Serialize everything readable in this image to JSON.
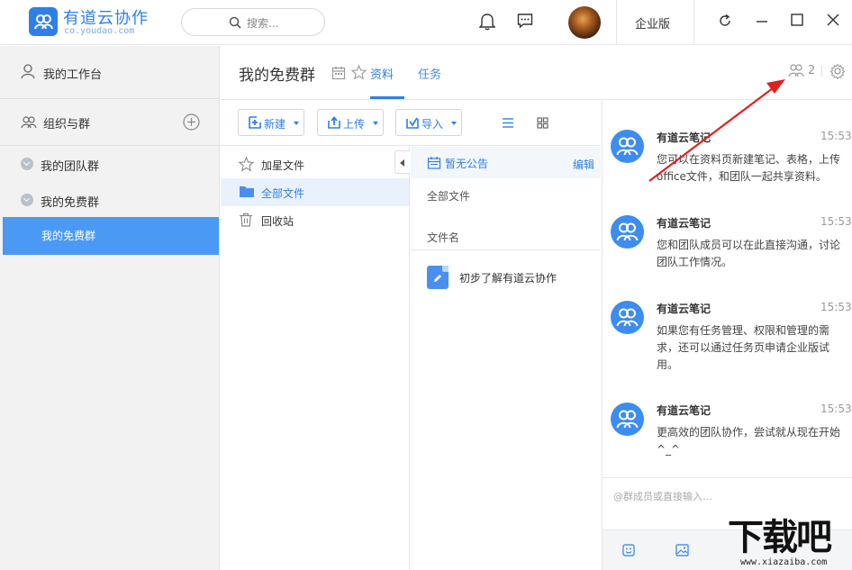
{
  "app": {
    "brand_name": "有道云协作",
    "brand_url": "co.youdao.com",
    "search_placeholder": "搜索...",
    "edition_label": "企业版"
  },
  "sidebar": {
    "workspace": "我的工作台",
    "orgs": "组织与群",
    "groups": [
      {
        "label": "我的团队群"
      },
      {
        "label": "我的免费群"
      }
    ],
    "active_item": "我的免费群"
  },
  "content": {
    "group_title": "我的免费群",
    "tabs": [
      {
        "label": "资料",
        "active": true
      },
      {
        "label": "任务",
        "active": false
      }
    ],
    "member_count": "2"
  },
  "toolbar": {
    "new_label": "新建",
    "upload_label": "上传",
    "import_label": "导入"
  },
  "folders": [
    {
      "label": "加星文件",
      "icon": "star-icon"
    },
    {
      "label": "全部文件",
      "icon": "folder-icon",
      "active": true
    },
    {
      "label": "回收站",
      "icon": "trash-icon"
    }
  ],
  "filelist": {
    "notice": "暂无公告",
    "notice_edit": "编辑",
    "breadcrumb": "全部文件",
    "column_header": "文件名",
    "files": [
      {
        "name": "初步了解有道云协作"
      }
    ]
  },
  "chat": {
    "messages": [
      {
        "sender": "有道云笔记",
        "time": "15:53",
        "text": "您可以在资料页新建笔记、表格，上传office文件，和团队一起共享资料。"
      },
      {
        "sender": "有道云笔记",
        "time": "15:53",
        "text": "您和团队成员可以在此直接沟通，讨论团队工作情况。"
      },
      {
        "sender": "有道云笔记",
        "time": "15:53",
        "text": "如果您有任务管理、权限和管理的需求，还可以通过任务页申请企业版试用。"
      },
      {
        "sender": "有道云笔记",
        "time": "15:53",
        "text": "更高效的团队协作，尝试就从现在开始^_^"
      }
    ],
    "input_placeholder": "@群成员或直接输入…"
  },
  "watermark": {
    "text": "下载吧",
    "url": "www.xiazaiba.com"
  },
  "colors": {
    "accent": "#2f7fe8",
    "active_item": "#4a9af5",
    "annotation_arrow": "#e02020"
  }
}
